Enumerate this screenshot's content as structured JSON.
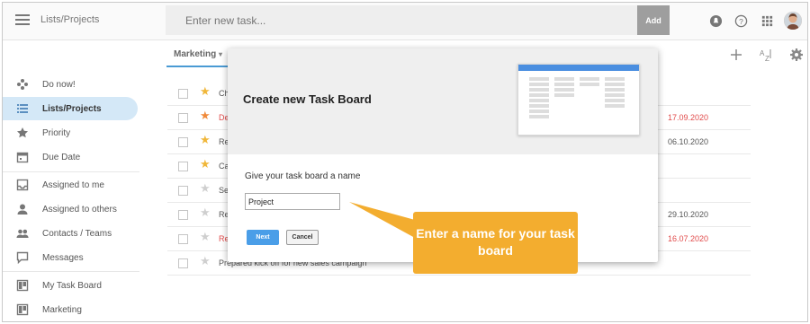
{
  "header": {
    "app_title": "Lists/Projects",
    "task_placeholder": "Enter new task...",
    "add_label": "Add"
  },
  "sidebar": {
    "items": [
      {
        "label": "Do now!",
        "icon": "gamepad-icon"
      },
      {
        "label": "Lists/Projects",
        "icon": "list-icon",
        "active": true
      },
      {
        "label": "Priority",
        "icon": "star-icon"
      },
      {
        "label": "Due Date",
        "icon": "calendar-icon"
      },
      {
        "label": "Assigned to me",
        "icon": "inbox-icon"
      },
      {
        "label": "Assigned to others",
        "icon": "person-icon"
      },
      {
        "label": "Contacts / Teams",
        "icon": "people-icon"
      },
      {
        "label": "Messages",
        "icon": "chat-icon"
      },
      {
        "label": "My Task Board",
        "icon": "board-icon"
      },
      {
        "label": "Marketing",
        "icon": "board-icon"
      }
    ]
  },
  "main": {
    "tab_label": "Marketing",
    "rows": [
      {
        "title": "Ch",
        "star": "gold",
        "date": "",
        "red": false
      },
      {
        "title": "De",
        "star": "orange",
        "date": "17.09.2020",
        "red": true
      },
      {
        "title": "Re",
        "star": "gold",
        "date": "06.10.2020",
        "red": false
      },
      {
        "title": "Ca",
        "star": "gold",
        "date": "",
        "red": false
      },
      {
        "title": "Se",
        "star": "grey",
        "date": "",
        "red": false
      },
      {
        "title": "Re",
        "star": "grey",
        "date": "29.10.2020",
        "red": false
      },
      {
        "title": "Re",
        "star": "grey",
        "date": "16.07.2020",
        "red": true
      },
      {
        "title": "Prepared kick off for new sales campaign",
        "star": "grey",
        "date": "",
        "red": false
      }
    ]
  },
  "dialog": {
    "title": "Create new Task Board",
    "prompt": "Give your task board a name",
    "input_value": "Project",
    "next_label": "Next",
    "cancel_label": "Cancel"
  },
  "callout": {
    "text": "Enter a name for your task board"
  },
  "colors": {
    "accent": "#4a9ee8",
    "callout": "#f3ad2f",
    "active_nav": "#d4e8f7",
    "overdue": "#e14b4b"
  }
}
